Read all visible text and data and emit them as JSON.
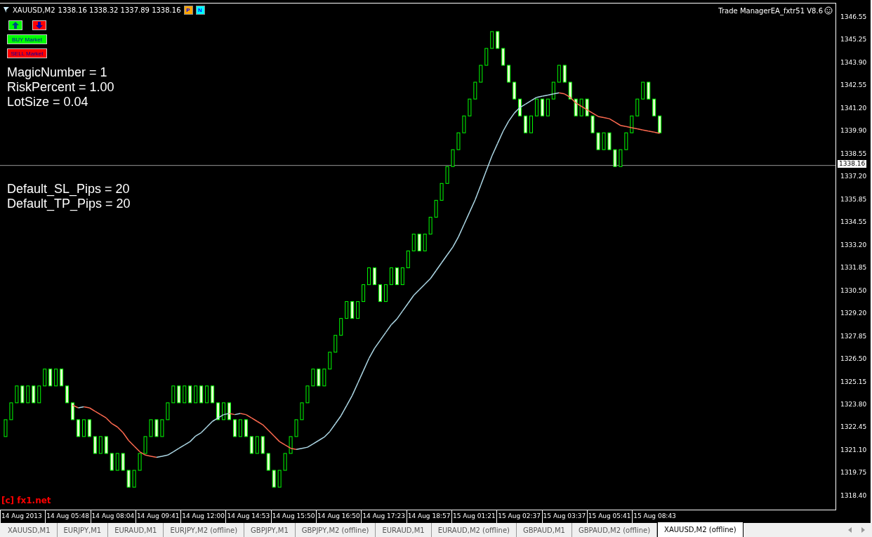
{
  "header": {
    "title": "XAUUSD,M2",
    "quotes": "1338.16 1338.32 1337.89 1338.16"
  },
  "nav_buttons": [
    {
      "label": "P",
      "color": "#ffa500"
    },
    {
      "label": "N",
      "color": "#00ffff"
    }
  ],
  "arrow_buttons": [
    {
      "kind": "up",
      "color": "#00ff00"
    },
    {
      "kind": "down",
      "color": "#ff0000"
    }
  ],
  "market_buttons": [
    {
      "label": "BUY Market",
      "color": "#00ff00"
    },
    {
      "label": "SELL Market",
      "color": "#ff0000"
    }
  ],
  "settings_lines": [
    "MagicNumber = 1",
    "RiskPercent = 1.00",
    "LotSize = 0.04"
  ],
  "default_lines": [
    "Default_SL_Pips = 20",
    "Default_TP_Pips = 20"
  ],
  "ea_label": "Trade ManagerEA_fxtr51 V8.6",
  "copyright": "[c] fx1.net",
  "price_axis": [
    "1346.55",
    "1345.25",
    "1343.90",
    "1342.55",
    "1341.20",
    "1339.90",
    "1338.55",
    "1337.20",
    "1335.85",
    "1334.55",
    "1333.20",
    "1331.85",
    "1330.50",
    "1329.20",
    "1327.85",
    "1326.50",
    "1325.15",
    "1323.80",
    "1322.45",
    "1321.10",
    "1319.75",
    "1318.40"
  ],
  "current_price": "1338.16",
  "time_axis": [
    "14 Aug 2013",
    "14 Aug 05:48",
    "14 Aug 08:04",
    "14 Aug 09:41",
    "14 Aug 12:00",
    "14 Aug 14:53",
    "14 Aug 15:50",
    "14 Aug 16:50",
    "14 Aug 17:23",
    "14 Aug 18:57",
    "15 Aug 01:21",
    "15 Aug 02:37",
    "15 Aug 03:37",
    "15 Aug 05:41",
    "15 Aug 08:43"
  ],
  "tabs": [
    {
      "label": "XAUUSD,M1",
      "selected": false
    },
    {
      "label": "EURJPY,M1",
      "selected": false
    },
    {
      "label": "EURAUD,M1",
      "selected": false
    },
    {
      "label": "EURJPY,M2 (offline)",
      "selected": false
    },
    {
      "label": "GBPJPY,M1",
      "selected": false
    },
    {
      "label": "GBPJPY,M2 (offline)",
      "selected": false
    },
    {
      "label": "EURAUD,M1",
      "selected": false
    },
    {
      "label": "EURAUD,M2 (offline)",
      "selected": false
    },
    {
      "label": "GBPAUD,M1",
      "selected": false
    },
    {
      "label": "GBPAUD,M2 (offline)",
      "selected": false
    },
    {
      "label": "XAUUSD,M2 (offline)",
      "selected": true
    }
  ]
}
